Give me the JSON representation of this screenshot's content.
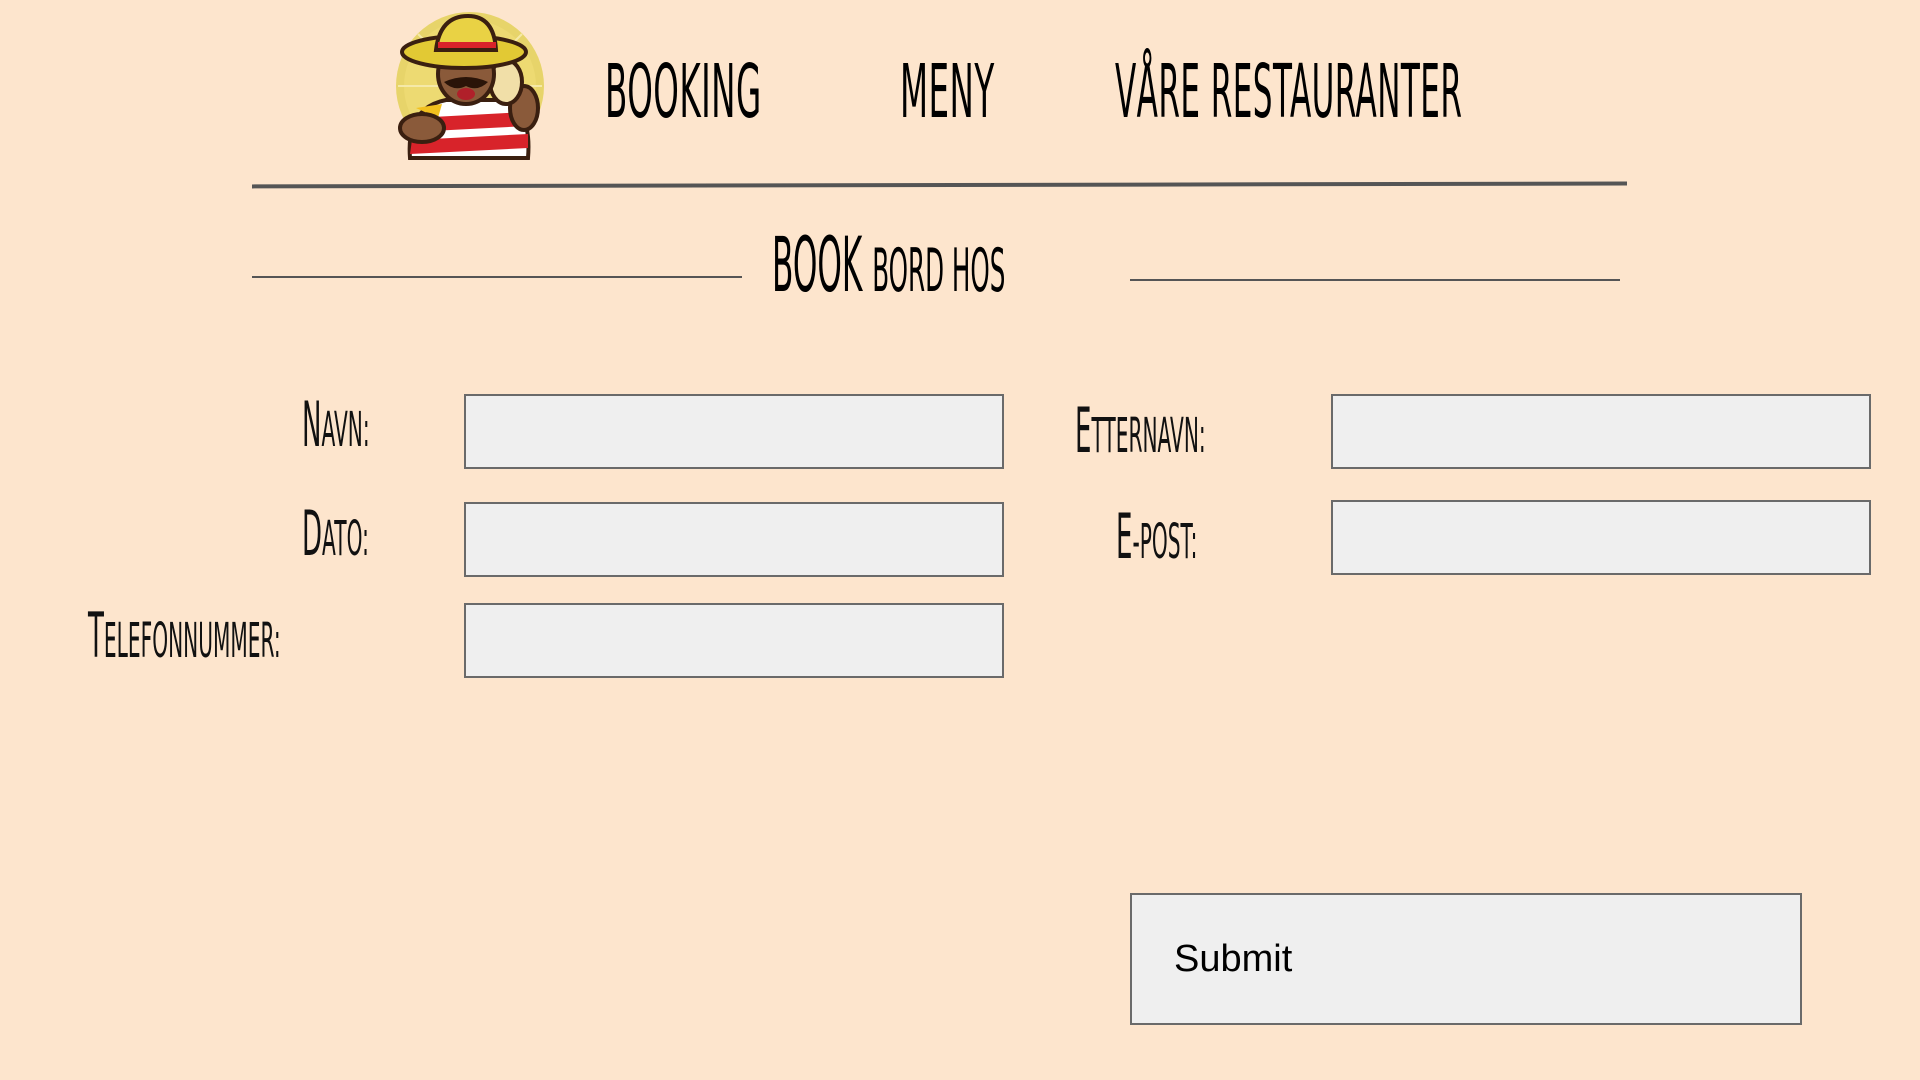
{
  "nav": {
    "links": [
      {
        "label": "BOOKING"
      },
      {
        "label": "MENY"
      },
      {
        "label": "VÅRE RESTAURANTER"
      }
    ]
  },
  "heading": {
    "big": "BOOK",
    "small": "BORD HOS"
  },
  "form": {
    "navn": {
      "first": "N",
      "rest": "AVN:",
      "value": ""
    },
    "dato": {
      "first": "D",
      "rest": "ATO:",
      "value": ""
    },
    "telefon": {
      "first": "T",
      "rest": "ELEFONNUMMER:",
      "value": ""
    },
    "etternavn": {
      "first": "E",
      "rest": "TTERNAVN:",
      "value": ""
    },
    "epost": {
      "first": "E",
      "rest": "-POST:",
      "value": ""
    },
    "submit_label": "Submit"
  },
  "colors": {
    "background": "#fde5cd",
    "field_background": "#efefef",
    "border": "#6a6a6a",
    "logo_sun": "#e2c934",
    "logo_shirt_red": "#d8232a"
  },
  "icons": {
    "logo": "mexican-mascot-logo-icon"
  }
}
